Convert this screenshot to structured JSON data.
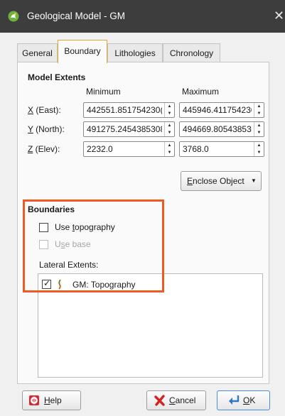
{
  "window": {
    "title": "Geological Model - GM",
    "close_glyph": "✕",
    "app_icon": "leapfrog-app-icon"
  },
  "tabs": [
    {
      "label": "General",
      "active": false
    },
    {
      "label": "Boundary",
      "active": true
    },
    {
      "label": "Lithologies",
      "active": false
    },
    {
      "label": "Chronology",
      "active": false
    }
  ],
  "model_extents": {
    "heading": "Model Extents",
    "col_min": "Minimum",
    "col_max": "Maximum",
    "rows": [
      {
        "mnemonic": "X",
        "rest": " (East):",
        "min": "442551.851754230(",
        "max": "445946.411754230!"
      },
      {
        "mnemonic": "Y",
        "rest": " (North):",
        "min": "491275.2454385308",
        "max": "494669.805438530!"
      },
      {
        "mnemonic": "Z",
        "rest": " (Elev):",
        "min": "2232.0",
        "max": "3768.0"
      }
    ],
    "enclose_mnemonic": "E",
    "enclose_rest": "nclose Object",
    "enclose_arrow": "▼"
  },
  "boundaries": {
    "heading": "Boundaries",
    "use_topography": {
      "pre": "Use ",
      "mnemonic": "t",
      "post": "opography",
      "checked": false
    },
    "use_base": {
      "pre": "U",
      "mnemonic": "s",
      "post": "e base",
      "checked": false,
      "enabled": false
    },
    "lateral_label": "Lateral Extents:",
    "lateral_items": [
      {
        "label": "GM: Topography",
        "checked": true,
        "icon": "topography-surface-icon"
      }
    ]
  },
  "buttons": {
    "help": {
      "mnemonic": "H",
      "rest": "elp"
    },
    "cancel": {
      "mnemonic": "C",
      "rest": "ancel"
    },
    "ok": {
      "mnemonic": "O",
      "rest": "K"
    }
  },
  "colors": {
    "titlebar": "#3d3d3d",
    "highlight_box": "#ee5a24",
    "active_tab_border": "#e4a531"
  }
}
